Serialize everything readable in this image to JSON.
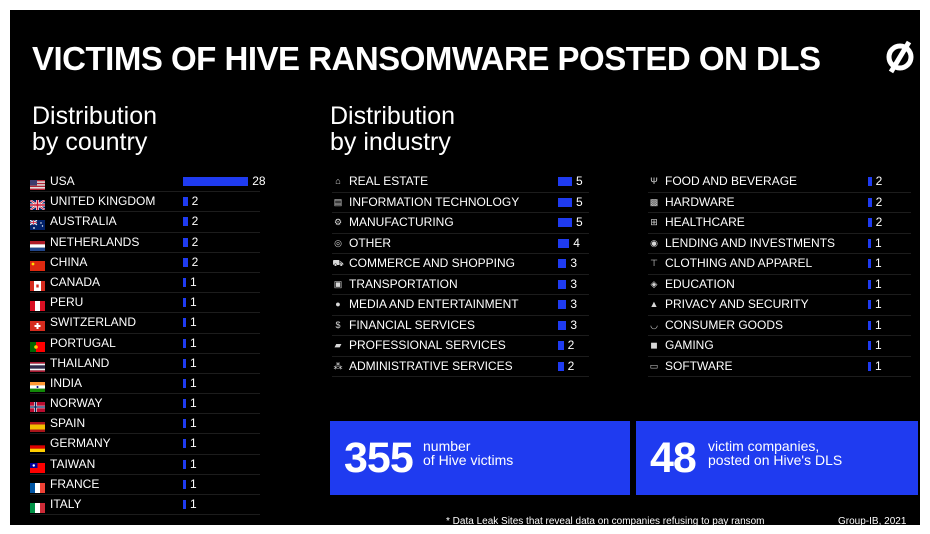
{
  "header": {
    "title": "VICTIMS OF HIVE RANSOMWARE POSTED ON DLS",
    "logo_icon": "group-ib-logo-icon"
  },
  "sections": {
    "country_line1": "Distribution",
    "country_line2": "by country",
    "industry_line1": "Distribution",
    "industry_line2": "by industry"
  },
  "chart_data": [
    {
      "type": "bar",
      "orientation": "horizontal",
      "title": "Distribution by country",
      "categories": [
        "USA",
        "UNITED KINGDOM",
        "AUSTRALIA",
        "NETHERLANDS",
        "CHINA",
        "CANADA",
        "PERU",
        "SWITZERLAND",
        "PORTUGAL",
        "THAILAND",
        "INDIA",
        "NORWAY",
        "SPAIN",
        "GERMANY",
        "TAIWAN",
        "FRANCE",
        "ITALY"
      ],
      "values": [
        28,
        2,
        2,
        2,
        2,
        1,
        1,
        1,
        1,
        1,
        1,
        1,
        1,
        1,
        1,
        1,
        1
      ],
      "flags": [
        "us",
        "gb",
        "au",
        "nl",
        "cn",
        "ca",
        "pe",
        "ch",
        "pt",
        "th",
        "in",
        "no",
        "es",
        "de",
        "tw",
        "fr",
        "it"
      ],
      "bar_color": "#1f3bf0"
    },
    {
      "type": "bar",
      "orientation": "horizontal",
      "title": "Distribution by industry",
      "categories": [
        "REAL ESTATE",
        "INFORMATION TECHNOLOGY",
        "MANUFACTURING",
        "OTHER",
        "COMMERCE AND SHOPPING",
        "TRANSPORTATION",
        "MEDIA AND ENTERTAINMENT",
        "FINANCIAL SERVICES",
        "PROFESSIONAL SERVICES",
        "ADMINISTRATIVE SERVICES"
      ],
      "values": [
        5,
        5,
        5,
        4,
        3,
        3,
        3,
        3,
        2,
        2
      ],
      "icons": [
        "building-icon",
        "server-icon",
        "gear-icon",
        "circle-icon",
        "cart-icon",
        "bus-icon",
        "globe-icon",
        "dollar-icon",
        "briefcase-icon",
        "people-icon"
      ],
      "bar_color": "#1f3bf0"
    },
    {
      "type": "bar",
      "orientation": "horizontal",
      "title": "Distribution by industry",
      "categories": [
        "FOOD AND BEVERAGE",
        "HARDWARE",
        "HEALTHCARE",
        "LENDING AND INVESTMENTS",
        "CLOTHING AND APPAREL",
        "EDUCATION",
        "PRIVACY AND SECURITY",
        "CONSUMER GOODS",
        "GAMING",
        "SOFTWARE"
      ],
      "values": [
        2,
        2,
        2,
        1,
        1,
        1,
        1,
        1,
        1,
        1
      ],
      "icons": [
        "fork-knife-icon",
        "chip-icon",
        "medical-cross-icon",
        "coins-icon",
        "shirt-icon",
        "graduation-cap-icon",
        "lock-icon",
        "basket-icon",
        "gamepad-icon",
        "monitor-icon"
      ],
      "bar_color": "#1f3bf0"
    }
  ],
  "stats": {
    "victims_number": "355",
    "victims_line1": "number",
    "victims_line2": "of Hive victims",
    "companies_number": "48",
    "companies_line1": "victim companies,",
    "companies_line2": "posted on Hive's DLS"
  },
  "footer": {
    "footnote": "* Data Leak Sites that reveal data on companies refusing to pay ransom",
    "credit": "Group-IB, 2021"
  }
}
